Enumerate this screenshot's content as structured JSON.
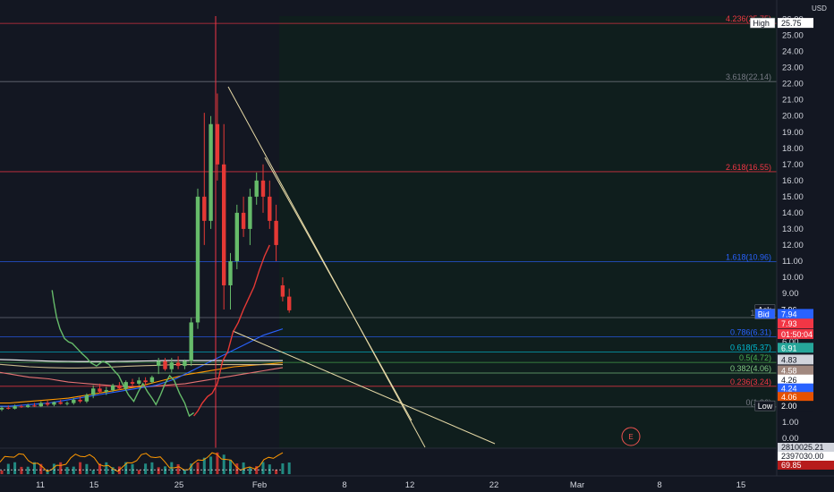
{
  "chart_data": {
    "type": "candlestick",
    "currency": "USD",
    "y_ticks": [
      0.0,
      1.0,
      2.0,
      3.0,
      4.0,
      5.0,
      6.0,
      7.0,
      8.0,
      9.0,
      10.0,
      11.0,
      12.0,
      13.0,
      14.0,
      15.0,
      16.0,
      17.0,
      18.0,
      19.0,
      20.0,
      21.0,
      22.0,
      23.0,
      24.0,
      25.0,
      26.0
    ],
    "ylim": [
      -0.6,
      26.2
    ],
    "x_ticks": [
      "11",
      "15",
      "25",
      "Feb",
      "8",
      "12",
      "22",
      "Mar",
      "8",
      "15"
    ],
    "fib_levels": [
      {
        "label": "4.236(25.75)",
        "value": 25.75,
        "color": "#f23645"
      },
      {
        "label": "3.618(22.14)",
        "value": 22.14,
        "color": "#787b86"
      },
      {
        "label": "2.618(16.55)",
        "value": 16.55,
        "color": "#f23645"
      },
      {
        "label": "1.618(10.96)",
        "value": 10.96,
        "color": "#2962ff"
      },
      {
        "label": "1(7.5)",
        "value": 7.5,
        "color": "#787b86"
      },
      {
        "label": "0.786(6.31)",
        "value": 6.31,
        "color": "#2962ff"
      },
      {
        "label": "0.618(5.37)",
        "value": 5.37,
        "color": "#00bcd4"
      },
      {
        "label": "0.5(4.72)",
        "value": 4.72,
        "color": "#4caf50"
      },
      {
        "label": "0.382(4.06)",
        "value": 4.06,
        "color": "#81c784"
      },
      {
        "label": "0.236(3.24)",
        "value": 3.24,
        "color": "#f23645"
      },
      {
        "label": "0(1.96)",
        "value": 1.96,
        "color": "#787b86"
      }
    ],
    "price_tags": [
      {
        "label": "High",
        "value": "25.75",
        "y": 25.75,
        "bg": "#ffffff",
        "fg": "#131722"
      },
      {
        "label": "Ask",
        "value": "7.96",
        "y": 7.96,
        "bg": "#131722",
        "fg": "#ffffff"
      },
      {
        "label": "Bid",
        "value": "7.94",
        "y": 7.7,
        "bg": "#2962ff",
        "fg": "#ffffff"
      },
      {
        "label": "",
        "value": "7.93",
        "y": 7.1,
        "bg": "#f23645",
        "fg": "#ffffff"
      },
      {
        "label": "",
        "value": "01:50:04",
        "y": 6.45,
        "bg": "#f23645",
        "fg": "#ffffff"
      },
      {
        "label": "",
        "value": "6.91",
        "y": 5.6,
        "bg": "#26a69a",
        "fg": "#ffffff"
      },
      {
        "label": "",
        "value": "4.83",
        "y": 4.87,
        "bg": "#d1d4dc",
        "fg": "#131722"
      },
      {
        "label": "",
        "value": "4.58",
        "y": 4.2,
        "bg": "#a1887f",
        "fg": "#ffffff"
      },
      {
        "label": "",
        "value": "4.26",
        "y": 3.63,
        "bg": "#ffffff",
        "fg": "#131722"
      },
      {
        "label": "",
        "value": "4.24",
        "y": 3.08,
        "bg": "#2962ff",
        "fg": "#ffffff"
      },
      {
        "label": "",
        "value": "4.06",
        "y": 2.55,
        "bg": "#e65100",
        "fg": "#ffffff"
      },
      {
        "label": "Low",
        "value": "2.00",
        "y": 2.0,
        "bg": "#131722",
        "fg": "#ffffff"
      }
    ],
    "indicator_values": [
      "2810025.21",
      "2397030.00",
      "69.85"
    ],
    "annotation_letter": "E",
    "candles": [
      {
        "o": 1.8,
        "h": 2.0,
        "l": 1.7,
        "c": 1.9
      },
      {
        "o": 1.9,
        "h": 2.05,
        "l": 1.8,
        "c": 1.85
      },
      {
        "o": 1.85,
        "h": 2.1,
        "l": 1.8,
        "c": 2.0
      },
      {
        "o": 2.0,
        "h": 2.1,
        "l": 1.9,
        "c": 1.95
      },
      {
        "o": 1.95,
        "h": 2.15,
        "l": 1.9,
        "c": 2.05
      },
      {
        "o": 2.05,
        "h": 2.2,
        "l": 1.95,
        "c": 2.0
      },
      {
        "o": 2.0,
        "h": 2.3,
        "l": 1.95,
        "c": 2.2
      },
      {
        "o": 2.2,
        "h": 2.35,
        "l": 2.0,
        "c": 2.1
      },
      {
        "o": 2.1,
        "h": 2.3,
        "l": 2.0,
        "c": 2.25
      },
      {
        "o": 2.25,
        "h": 2.4,
        "l": 2.1,
        "c": 2.15
      },
      {
        "o": 2.15,
        "h": 2.3,
        "l": 2.05,
        "c": 2.2
      },
      {
        "o": 2.2,
        "h": 2.5,
        "l": 2.1,
        "c": 2.4
      },
      {
        "o": 2.4,
        "h": 2.6,
        "l": 2.2,
        "c": 2.3
      },
      {
        "o": 2.3,
        "h": 2.8,
        "l": 2.2,
        "c": 2.7
      },
      {
        "o": 2.7,
        "h": 3.3,
        "l": 2.5,
        "c": 3.1
      },
      {
        "o": 3.1,
        "h": 3.4,
        "l": 2.8,
        "c": 2.9
      },
      {
        "o": 2.9,
        "h": 3.2,
        "l": 2.7,
        "c": 3.0
      },
      {
        "o": 3.0,
        "h": 3.4,
        "l": 2.9,
        "c": 3.3
      },
      {
        "o": 3.3,
        "h": 3.5,
        "l": 3.0,
        "c": 3.1
      },
      {
        "o": 3.1,
        "h": 3.6,
        "l": 3.0,
        "c": 3.5
      },
      {
        "o": 3.5,
        "h": 3.7,
        "l": 3.2,
        "c": 3.4
      },
      {
        "o": 3.4,
        "h": 3.8,
        "l": 3.3,
        "c": 3.6
      },
      {
        "o": 3.6,
        "h": 3.8,
        "l": 3.3,
        "c": 3.5
      },
      {
        "o": 3.5,
        "h": 3.9,
        "l": 3.4,
        "c": 3.8
      },
      {
        "o": 4.5,
        "h": 5.0,
        "l": 4.0,
        "c": 4.8
      },
      {
        "o": 4.8,
        "h": 5.0,
        "l": 4.2,
        "c": 4.3
      },
      {
        "o": 4.3,
        "h": 5.0,
        "l": 4.1,
        "c": 4.7
      },
      {
        "o": 4.7,
        "h": 5.1,
        "l": 4.3,
        "c": 4.5
      },
      {
        "o": 4.5,
        "h": 4.9,
        "l": 4.3,
        "c": 4.8
      },
      {
        "o": 4.8,
        "h": 7.5,
        "l": 4.5,
        "c": 7.2
      },
      {
        "o": 7.2,
        "h": 15.5,
        "l": 6.8,
        "c": 15.0
      },
      {
        "o": 15.0,
        "h": 20.2,
        "l": 12.0,
        "c": 13.5
      },
      {
        "o": 13.5,
        "h": 20.0,
        "l": 13.0,
        "c": 19.5
      },
      {
        "o": 19.5,
        "h": 21.4,
        "l": 16.0,
        "c": 17.0
      },
      {
        "o": 17.0,
        "h": 19.5,
        "l": 8.0,
        "c": 9.5
      },
      {
        "o": 9.5,
        "h": 11.5,
        "l": 8.0,
        "c": 11.0
      },
      {
        "o": 11.0,
        "h": 14.5,
        "l": 10.5,
        "c": 14.0
      },
      {
        "o": 14.0,
        "h": 15.0,
        "l": 12.5,
        "c": 13.0
      },
      {
        "o": 13.0,
        "h": 15.5,
        "l": 12.0,
        "c": 15.0
      },
      {
        "o": 15.0,
        "h": 16.5,
        "l": 14.5,
        "c": 16.0
      },
      {
        "o": 16.0,
        "h": 17.0,
        "l": 14.0,
        "c": 15.0
      },
      {
        "o": 15.0,
        "h": 16.0,
        "l": 13.0,
        "c": 13.5
      },
      {
        "o": 13.5,
        "h": 14.5,
        "l": 11.0,
        "c": 12.0
      },
      {
        "o": 9.5,
        "h": 10.0,
        "l": 8.5,
        "c": 8.8
      },
      {
        "o": 8.8,
        "h": 9.3,
        "l": 7.8,
        "c": 7.95
      }
    ],
    "ma_series": [
      {
        "color": "#e57373",
        "values": [
          4.1,
          4.0,
          3.9,
          3.8,
          3.75,
          3.7,
          3.6,
          3.5,
          3.45,
          3.4,
          3.35,
          3.3,
          3.25,
          3.2,
          3.2,
          3.2,
          3.25,
          3.3,
          3.35,
          3.4,
          3.5,
          3.6,
          3.7,
          3.8,
          3.9,
          4.0,
          4.1,
          4.2,
          4.3,
          4.4
        ]
      },
      {
        "color": "#ff9800",
        "values": [
          2.2,
          2.2,
          2.25,
          2.3,
          2.35,
          2.4,
          2.45,
          2.5,
          2.6,
          2.7,
          2.8,
          2.9,
          3.0,
          3.1,
          3.2,
          3.35,
          3.5,
          3.65,
          3.8,
          3.95,
          4.05,
          4.15,
          4.25,
          4.35,
          4.45,
          4.5,
          4.55,
          4.6,
          4.65,
          4.7
        ]
      },
      {
        "color": "#2962ff",
        "values": [
          2.0,
          2.0,
          2.05,
          2.1,
          2.15,
          2.2,
          2.3,
          2.4,
          2.5,
          2.6,
          2.7,
          2.8,
          2.9,
          3.0,
          3.1,
          3.2,
          3.3,
          3.5,
          3.7,
          4.0,
          4.3,
          4.6,
          4.9,
          5.2,
          5.5,
          5.8,
          6.1,
          6.4,
          6.6,
          6.8
        ]
      },
      {
        "color": "#ffffff",
        "values": [
          4.9,
          4.88,
          4.86,
          4.84,
          4.82,
          4.8,
          4.79,
          4.78,
          4.77,
          4.77,
          4.77,
          4.77,
          4.78,
          4.79,
          4.8,
          4.81,
          4.82,
          4.83,
          4.83,
          4.83,
          4.83,
          4.83,
          4.83,
          4.83,
          4.83,
          4.83,
          4.83,
          4.83,
          4.83,
          4.83
        ]
      },
      {
        "color": "#c8b88a",
        "values": [
          4.6,
          4.55,
          4.5,
          4.45,
          4.42,
          4.4,
          4.38,
          4.37,
          4.37,
          4.38,
          4.4,
          4.42,
          4.45,
          4.48,
          4.5,
          4.52,
          4.54,
          4.56,
          4.58,
          4.58,
          4.58,
          4.58,
          4.58,
          4.58,
          4.58,
          4.58,
          4.58,
          4.58,
          4.58,
          4.58
        ]
      }
    ],
    "projection_green": [
      [
        7.7,
        9.2
      ],
      [
        8.0,
        8.4
      ],
      [
        8.4,
        7.5
      ],
      [
        8.9,
        6.8
      ],
      [
        9.6,
        6.2
      ],
      [
        10.2,
        6.0
      ],
      [
        10.8,
        5.9
      ],
      [
        11.5,
        5.6
      ],
      [
        12.2,
        5.3
      ],
      [
        13.0,
        5.0
      ],
      [
        13.6,
        4.7
      ],
      [
        14.5,
        4.5
      ],
      [
        15.5,
        4.8
      ],
      [
        16.4,
        4.6
      ],
      [
        17.2,
        4.2
      ],
      [
        17.9,
        3.9
      ],
      [
        18.6,
        3.3
      ],
      [
        19.4,
        2.7
      ],
      [
        20.2,
        2.3
      ],
      [
        20.9,
        2.9
      ],
      [
        21.6,
        3.4
      ],
      [
        22.3,
        2.9
      ],
      [
        23.0,
        2.5
      ],
      [
        23.6,
        2.1
      ],
      [
        24.3,
        2.7
      ],
      [
        25.0,
        3.4
      ],
      [
        25.7,
        3.9
      ],
      [
        26.4,
        3.6
      ],
      [
        27.2,
        2.8
      ],
      [
        28.0,
        2.2
      ],
      [
        28.7,
        1.4
      ],
      [
        29.4,
        1.6
      ]
    ],
    "projection_red": [
      [
        29.4,
        1.4
      ],
      [
        30.0,
        1.7
      ],
      [
        30.7,
        2.2
      ],
      [
        31.5,
        2.6
      ],
      [
        32.2,
        2.8
      ],
      [
        33.0,
        3.4
      ],
      [
        33.8,
        4.8
      ],
      [
        34.6,
        5.4
      ],
      [
        35.4,
        6.6
      ],
      [
        36.2,
        7.2
      ],
      [
        37.0,
        8.0
      ],
      [
        37.8,
        8.7
      ],
      [
        38.6,
        9.4
      ],
      [
        39.4,
        10.4
      ],
      [
        40.2,
        11.3
      ],
      [
        41.0,
        12.0
      ]
    ]
  }
}
